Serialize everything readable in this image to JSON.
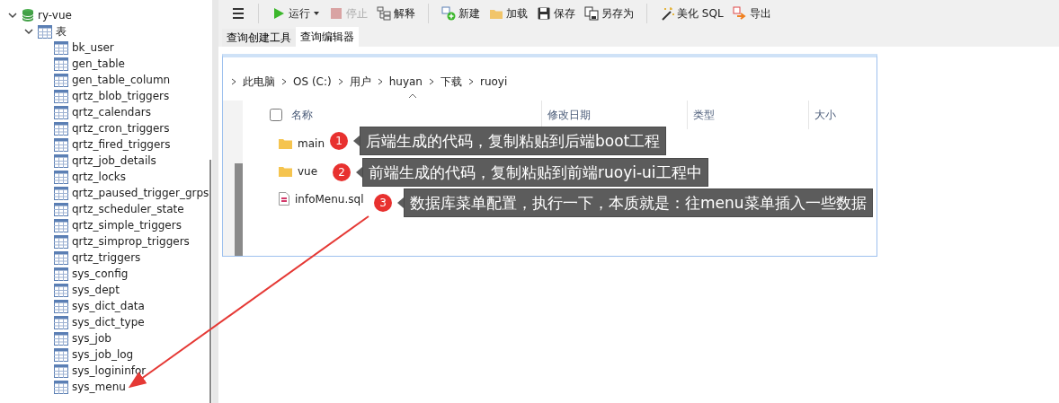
{
  "sidebar": {
    "items": [
      {
        "label": "ry-vue",
        "kind": "database",
        "open": true,
        "expanded": true,
        "children": [
          {
            "label": "表",
            "kind": "folder",
            "expanded": true,
            "children": [
              {
                "label": "bk_user",
                "kind": "table"
              },
              {
                "label": "gen_table",
                "kind": "table"
              },
              {
                "label": "gen_table_column",
                "kind": "table"
              },
              {
                "label": "qrtz_blob_triggers",
                "kind": "table"
              },
              {
                "label": "qrtz_calendars",
                "kind": "table"
              },
              {
                "label": "qrtz_cron_triggers",
                "kind": "table"
              },
              {
                "label": "qrtz_fired_triggers",
                "kind": "table"
              },
              {
                "label": "qrtz_job_details",
                "kind": "table"
              },
              {
                "label": "qrtz_locks",
                "kind": "table"
              },
              {
                "label": "qrtz_paused_trigger_grps",
                "kind": "table"
              },
              {
                "label": "qrtz_scheduler_state",
                "kind": "table"
              },
              {
                "label": "qrtz_simple_triggers",
                "kind": "table"
              },
              {
                "label": "qrtz_simprop_triggers",
                "kind": "table"
              },
              {
                "label": "qrtz_triggers",
                "kind": "table"
              },
              {
                "label": "sys_config",
                "kind": "table"
              },
              {
                "label": "sys_dept",
                "kind": "table"
              },
              {
                "label": "sys_dict_data",
                "kind": "table"
              },
              {
                "label": "sys_dict_type",
                "kind": "table"
              },
              {
                "label": "sys_job",
                "kind": "table"
              },
              {
                "label": "sys_job_log",
                "kind": "table"
              },
              {
                "label": "sys_logininfor",
                "kind": "table"
              },
              {
                "label": "sys_menu",
                "kind": "table"
              }
            ]
          }
        ]
      }
    ]
  },
  "toolbar": [
    {
      "kind": "menu"
    },
    {
      "kind": "separator"
    },
    {
      "kind": "run",
      "label": "运行",
      "disabled": false,
      "dropdown": true
    },
    {
      "kind": "stop",
      "label": "停止",
      "disabled": true
    },
    {
      "kind": "explain",
      "label": "解释",
      "disabled": false
    },
    {
      "kind": "separator"
    },
    {
      "kind": "new",
      "label": "新建",
      "disabled": false
    },
    {
      "kind": "load",
      "label": "加载",
      "disabled": false
    },
    {
      "kind": "save",
      "label": "保存",
      "disabled": false
    },
    {
      "kind": "save_as",
      "label": "另存为",
      "disabled": false
    },
    {
      "kind": "separator"
    },
    {
      "kind": "beautify",
      "label": "美化 SQL",
      "disabled": false
    },
    {
      "kind": "export",
      "label": "导出",
      "disabled": false
    }
  ],
  "tabs": [
    {
      "label": "查询创建工具",
      "selected": false
    },
    {
      "label": "查询编辑器",
      "selected": true
    }
  ],
  "explorer": {
    "breadcrumb": [
      "此电脑",
      "OS (C:)",
      "用户",
      "huyan",
      "下载",
      "ruoyi"
    ],
    "columns": [
      "名称",
      "修改日期",
      "类型",
      "大小"
    ],
    "rows": [
      {
        "kind": "folder",
        "name": "main"
      },
      {
        "kind": "folder",
        "name": "vue"
      },
      {
        "kind": "sql",
        "name": "infoMenu.sql"
      }
    ]
  },
  "annotations": [
    {
      "number": "1",
      "text": "后端生成的代码，复制粘贴到后端boot工程"
    },
    {
      "number": "2",
      "text": "前端生成的代码，复制粘贴到前端ruoyi-ui工程中"
    },
    {
      "number": "3",
      "text": "数据库菜单配置，执行一下，本质就是：往menu菜单插入一些数据"
    }
  ]
}
